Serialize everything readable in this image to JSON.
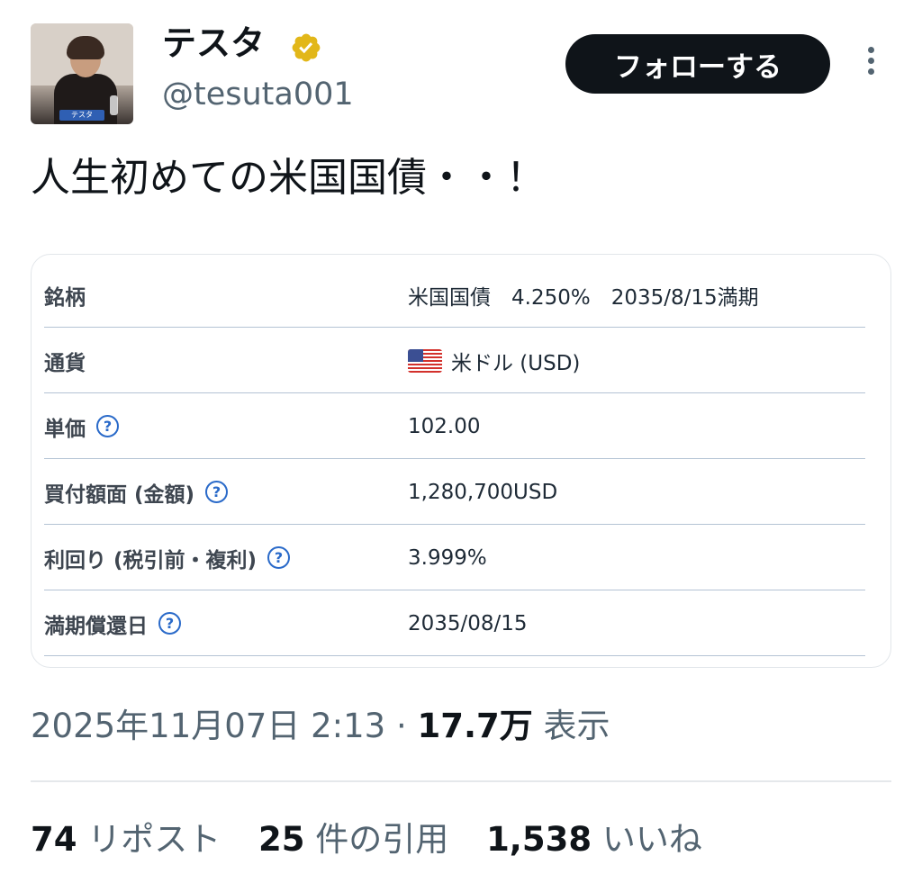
{
  "author": {
    "display_name": "テスタ",
    "handle": "@tesuta001",
    "verified": true,
    "avatar_nameplate": "テスタ"
  },
  "follow_button_label": "フォローする",
  "tweet_text": "人生初めての米国国債・・！",
  "card": {
    "rows": [
      {
        "label": "銘柄",
        "value": "米国国債　4.250%　2035/8/15満期",
        "has_help": false
      },
      {
        "label": "通貨",
        "value": "米ドル (USD)",
        "has_help": false,
        "flag": "us-flag-icon"
      },
      {
        "label": "単価",
        "value": "102.00",
        "has_help": true
      },
      {
        "label": "買付額面 (金額)",
        "value": "1,280,700USD",
        "has_help": true
      },
      {
        "label": "利回り (税引前・複利)",
        "value": "3.999%",
        "has_help": true
      },
      {
        "label": "満期償還日",
        "value": "2035/08/15",
        "has_help": true
      }
    ]
  },
  "meta": {
    "datetime": "2025年11月07日 2:13",
    "separator": " · ",
    "views": "17.7万",
    "views_label": "表示"
  },
  "stats": {
    "reposts": {
      "count": "74",
      "label": "リポスト"
    },
    "quotes": {
      "count": "25",
      "label": "件の引用"
    },
    "likes": {
      "count": "1,538",
      "label": "いいね"
    }
  },
  "colors": {
    "text_primary": "#0f1419",
    "text_secondary": "#536471",
    "follow_bg": "#0f1419",
    "verified_gold": "#e2b719",
    "help_blue": "#2a6ac9",
    "row_divider": "#b4c3d4"
  }
}
